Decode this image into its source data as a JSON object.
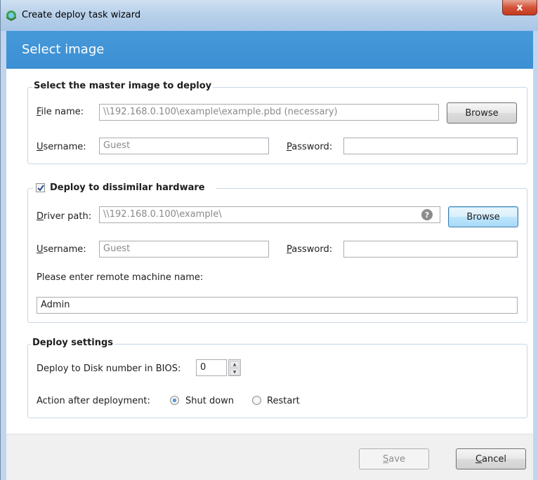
{
  "window": {
    "title": "Create deploy task wizard",
    "close_label": "x"
  },
  "header": {
    "title": "Select image"
  },
  "master_image": {
    "legend": "Select the master image to deploy",
    "file_label_prefix": "",
    "file_label_accel": "F",
    "file_label_rest": "ile name:",
    "file_placeholder": "\\\\192.168.0.100\\example\\example.pbd (necessary)",
    "browse_label": "Browse",
    "username_accel": "U",
    "username_rest": "sername:",
    "username_placeholder": "Guest",
    "password_accel": "P",
    "password_rest": "assword:",
    "password_value": ""
  },
  "dissimilar": {
    "legend": "Deploy to dissimilar hardware",
    "checked": true,
    "driver_accel": "D",
    "driver_rest": "river path:",
    "driver_placeholder": "\\\\192.168.0.100\\example\\",
    "help_glyph": "?",
    "browse_label": "Browse",
    "username_accel": "U",
    "username_rest": "sername:",
    "username_placeholder": "Guest",
    "password_accel": "P",
    "password_rest": "assword:",
    "password_value": "",
    "remote_label": "Please enter remote machine name:",
    "remote_value": "Admin"
  },
  "deploy_settings": {
    "legend": "Deploy settings",
    "disk_label": "Deploy to Disk number in BIOS:",
    "disk_value": "0",
    "action_label": "Action after deployment:",
    "options": [
      {
        "label": "Shut down",
        "selected": true
      },
      {
        "label": "Restart",
        "selected": false
      }
    ]
  },
  "footer": {
    "save_accel": "S",
    "save_rest": "ave",
    "cancel_accel": "C",
    "cancel_rest": "ancel"
  },
  "colors": {
    "header_blue": "#3b8fd3",
    "group_border": "#c8d6e6"
  }
}
